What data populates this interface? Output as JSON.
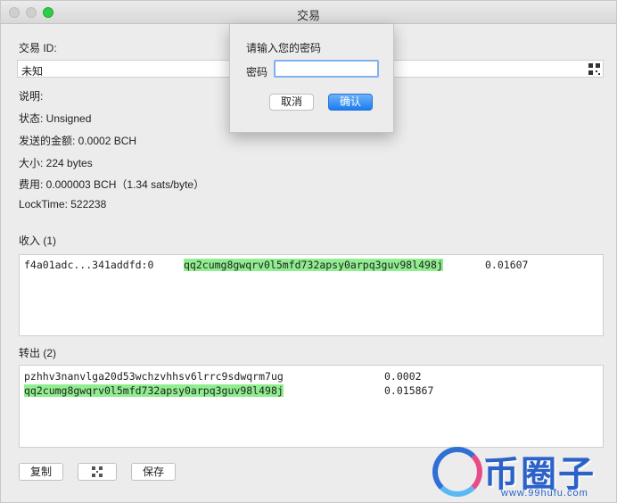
{
  "window": {
    "title": "交易"
  },
  "details": {
    "txid_label": "交易 ID:",
    "txid_value": "未知",
    "description_label": "说明:",
    "status": "状态: Unsigned",
    "amount_sent": "发送的金额: 0.0002 BCH",
    "size": "大小:  224 bytes",
    "fee": "费用: 0.000003 BCH（1.34 sats/byte）",
    "locktime": "LockTime: 522238"
  },
  "inputs": {
    "label": "收入 (1)",
    "rows": [
      {
        "prevout": "f4a01adc...341addfd:0",
        "address": "qq2cumg8gwqrv0l5mfd732apsy0arpq3guv98l498j",
        "amount": "0.01607"
      }
    ]
  },
  "outputs": {
    "label": "转出 (2)",
    "rows": [
      {
        "address": "pzhhv3nanvlga20d53wchzvhhsv6lrrc9sdwqrm7ug",
        "amount": "0.0002"
      },
      {
        "address": "qq2cumg8gwqrv0l5mfd732apsy0arpq3guv98l498j",
        "amount": "0.015867"
      }
    ]
  },
  "buttons": {
    "copy": "复制",
    "save": "保存"
  },
  "dialog": {
    "prompt": "请输入您的密码",
    "password_label": "密码",
    "cancel": "取消",
    "ok": "确认"
  },
  "watermark": {
    "text": "币圈子",
    "url": "www.99hufu.com"
  },
  "colors": {
    "highlight": "#90ee90",
    "primary_button": "#1b7cf2",
    "close_light": "#2ecc47"
  }
}
